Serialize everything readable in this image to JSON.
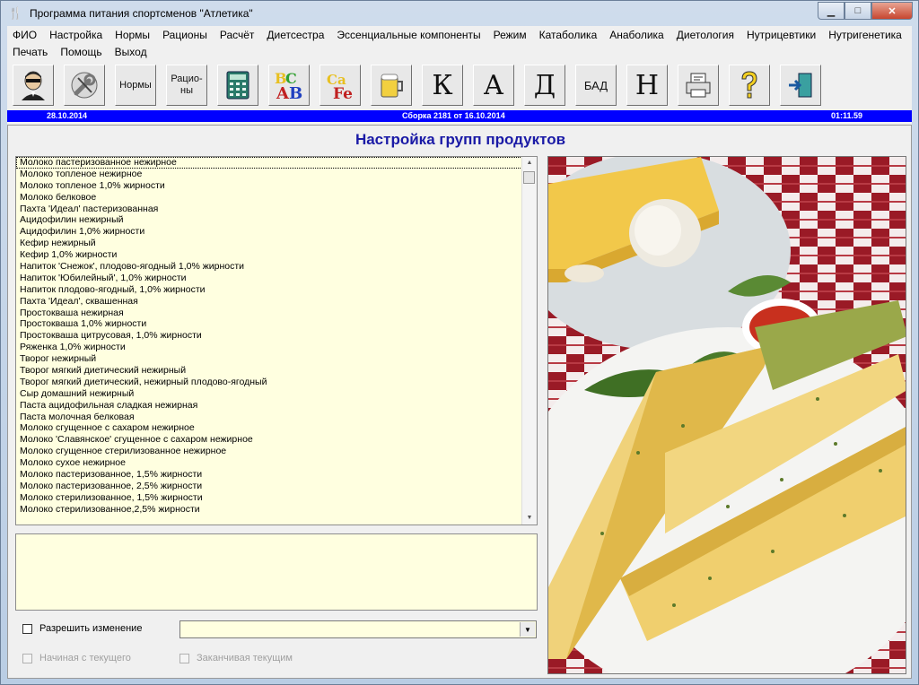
{
  "window": {
    "title": "Программа питания спортсменов \"Атлетика\""
  },
  "menu": {
    "row1": [
      "ФИО",
      "Настройка",
      "Нормы",
      "Рационы",
      "Расчёт",
      "Диетсестра",
      "Эссенциальные компоненты",
      "Режим",
      "Катаболика",
      "Анаболика",
      "Диетология",
      "Нутрицевтики",
      "Нутригенетика"
    ],
    "row2": [
      "Печать",
      "Помощь",
      "Выход"
    ]
  },
  "toolbar": {
    "normy": "Нормы",
    "raciony_1": "Рацио-",
    "raciony_2": "ны",
    "k": "К",
    "a": "А",
    "d": "Д",
    "bad": "БАД",
    "n": "Н"
  },
  "status": {
    "date": "28.10.2014",
    "build": "Сборка 2181 от 16.10.2014",
    "time": "01:11.59",
    "bar_color": "#0000ff"
  },
  "heading": "Настройка групп продуктов",
  "products": [
    "Молоко пастеризованное нежирное",
    "Молоко топленое нежирное",
    "Молоко топленое 1,0% жирности",
    "Молоко белковое",
    "Пахта 'Идеал' пастеризованная",
    "Ацидофилин нежирный",
    "Ацидофилин 1,0% жирности",
    "Кефир нежирный",
    "Кефир 1,0% жирности",
    "Напиток 'Снежок', плодово-ягодный 1,0% жирности",
    "Напиток 'Юбилейный', 1,0% жирности",
    "Напиток плодово-ягодный, 1,0% жирности",
    "Пахта 'Идеал', сквашенная",
    "Простокваша нежирная",
    "Простокваша 1,0% жирности",
    "Простокваша цитрусовая, 1,0% жирности",
    "Ряженка 1,0% жирности",
    "Творог нежирный",
    "Творог мягкий диетический нежирный",
    "Творог мягкий диетический, нежирный плодово-ягодный",
    "Сыр домашний нежирный",
    "Паста ацидофильная сладкая нежирная",
    "Паста молочная белковая",
    "Молоко сгущенное с сахаром нежирное",
    "Молоко 'Славянское' сгущенное с сахаром нежирное",
    "Молоко сгущенное стерилизованное нежирное",
    "Молоко сухое нежирное",
    "Молоко пастеризованное, 1,5% жирности",
    "Молоко пастеризованное, 2,5% жирности",
    "Молоко стерилизованное, 1,5% жирности",
    "Молоко стерилизованное,2,5% жирности"
  ],
  "controls": {
    "allow_change": "Разрешить изменение",
    "start_current": "Начиная с текущего",
    "end_current": "Заканчивая текущим"
  }
}
